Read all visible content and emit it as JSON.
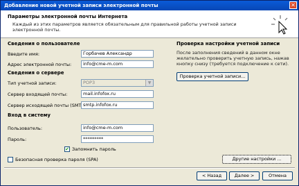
{
  "window": {
    "title": "Добавление новой учетной записи электронной почты",
    "close_glyph": "✕"
  },
  "header": {
    "title": "Параметры электронной почты Интернета",
    "subtitle": "Каждый из этих параметров является обязательным для правильной работы учетной записи электронной почты."
  },
  "user_info": {
    "heading": "Сведения о пользователе",
    "name_label": "Введите имя:",
    "name_value": "Горбачев Александр",
    "email_label": "Адрес электронной почты:",
    "email_value": "info@cme-m.com"
  },
  "server_info": {
    "heading": "Сведения о сервере",
    "account_type_label": "Тип учетной записи:",
    "account_type_value": "POP3",
    "incoming_label": "Сервер входящей почты:",
    "incoming_value": "mail.infofox.ru",
    "outgoing_label": "Сервер исходящей почты (SMTP):",
    "outgoing_value": "smtp.infofox.ru"
  },
  "logon_info": {
    "heading": "Вход в систему",
    "user_label": "Пользователь:",
    "user_value": "info@cme-m.com",
    "password_label": "Пароль:",
    "password_value": "*********",
    "remember_label": "Запомнить пароль",
    "remember_checked": true,
    "spa_label": "Безопасная проверка пароля (SPA)",
    "spa_checked": false
  },
  "test": {
    "heading": "Проверка настройки учетной записи",
    "text": "После заполнения сведений в данном окне желательно проверить учетную запись, нажав кнопку снизу (требуется подключение к сети).",
    "button": "Проверка учетной записи..."
  },
  "buttons": {
    "more_settings": "Другие настройки ...",
    "back": "< Назад",
    "next": "Далее >",
    "cancel": "Отмена"
  }
}
